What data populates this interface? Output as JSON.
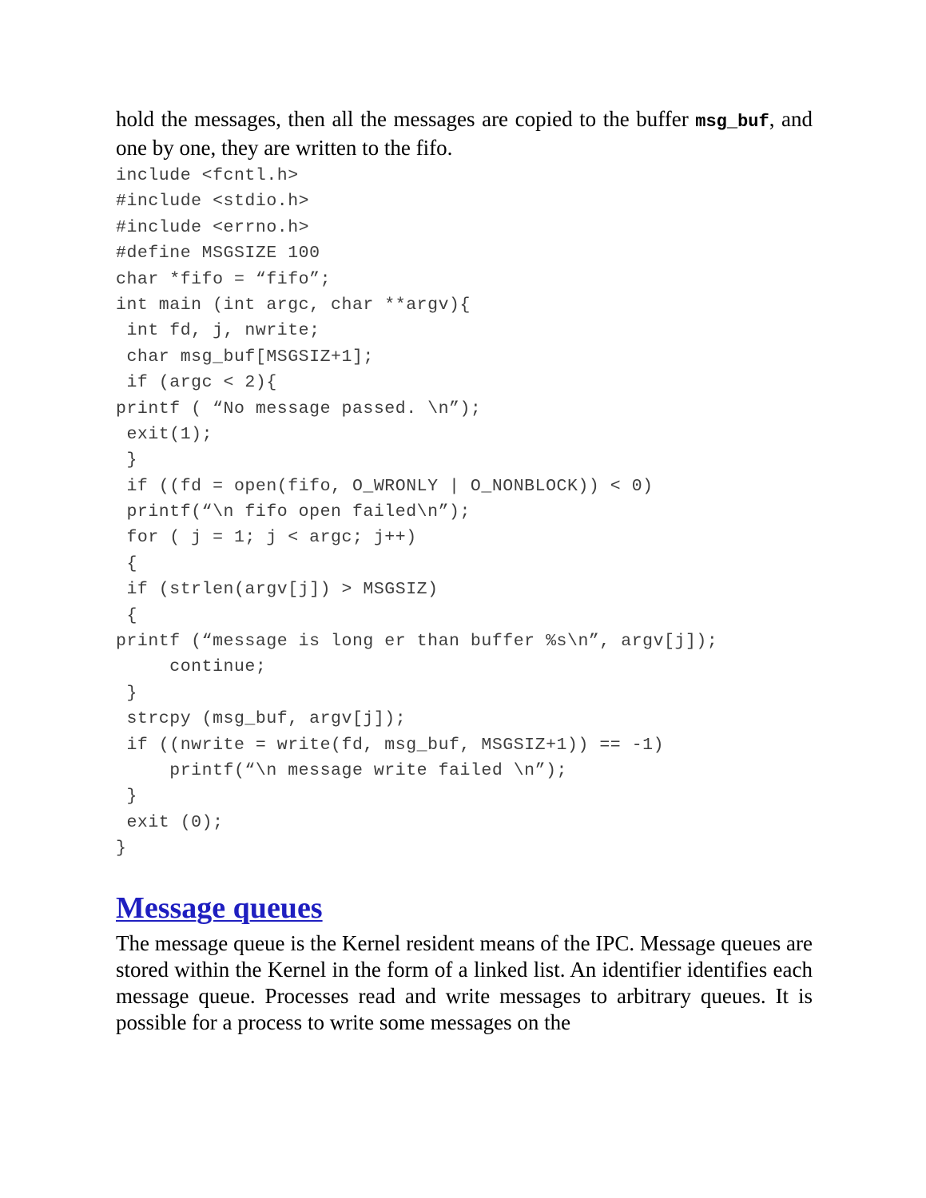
{
  "document": {
    "intro_paragraph": {
      "text_before": "hold the messages, then all the messages are copied to the buffer ",
      "code_term": "msg_buf",
      "text_after": ",",
      "continuation": "and one by one, they are written to the fifo."
    },
    "code_listing": {
      "language": "c",
      "lines": [
        "include <fcntl.h>",
        "#include <stdio.h>",
        "#include <errno.h>",
        "#define MSGSIZE 100",
        "char *fifo = “fifo”;",
        "int main (int argc, char **argv){",
        " int fd, j, nwrite;",
        " char msg_buf[MSGSIZ+1];",
        " if (argc < 2){",
        "printf ( “No message passed. \\n”);",
        " exit(1);",
        " }",
        " if ((fd = open(fifo, O_WRONLY | O_NONBLOCK)) < 0)",
        " printf(“\\n fifo open failed\\n”);",
        " for ( j = 1; j < argc; j++)",
        " {",
        " if (strlen(argv[j]) > MSGSIZ)",
        " {",
        "printf (“message is long er than buffer %s\\n”, argv[j]);",
        "     continue;",
        " }",
        " strcpy (msg_buf, argv[j]);",
        " if ((nwrite = write(fd, msg_buf, MSGSIZ+1)) == -1)",
        "     printf(“\\n message write failed \\n”);",
        " }",
        " exit (0);",
        "}"
      ]
    },
    "section": {
      "heading": "Message queues",
      "heading_color": "#1f1fc0",
      "body_paragraph": "The message queue is the Kernel resident means of the IPC. Message queues are stored within the Kernel in the form of a linked list. An identifier identifies each message queue. Processes read and write messages to arbitrary queues. It is possible for a process to write some messages on the"
    }
  }
}
